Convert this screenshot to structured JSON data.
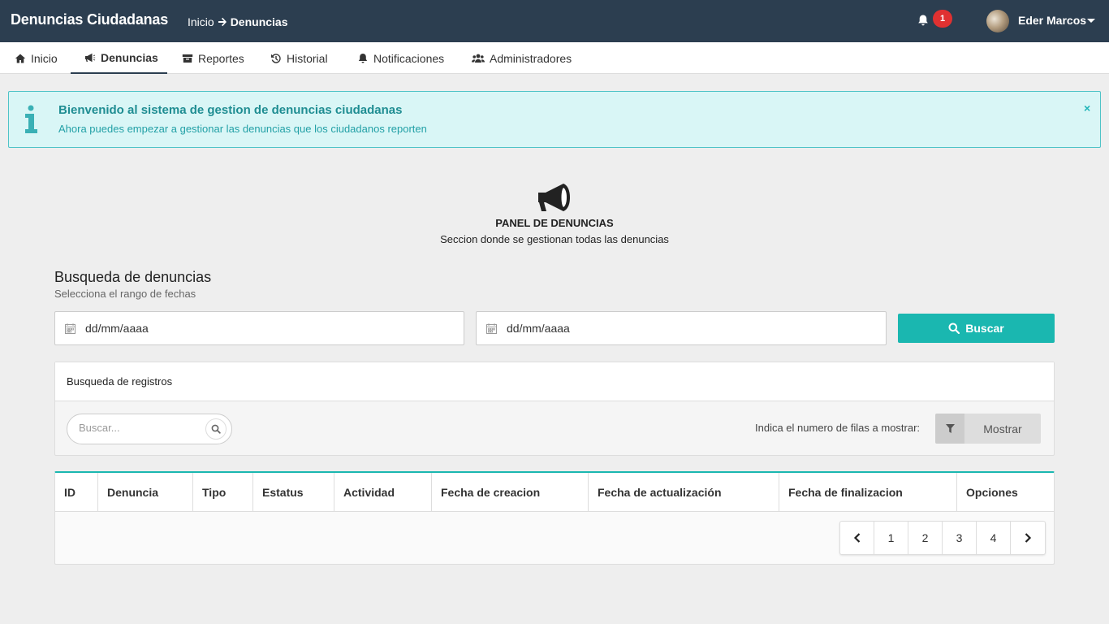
{
  "app": {
    "title": "Denuncias Ciudadanas",
    "breadcrumb": [
      "Inicio",
      "Denuncias"
    ],
    "notification_count": "1",
    "user_name": "Eder Marcos",
    "header_bg": "#2c3e50"
  },
  "nav": {
    "items": [
      {
        "label": "Inicio",
        "icon": "home-icon"
      },
      {
        "label": "Denuncias",
        "icon": "bullhorn-icon",
        "active": true
      },
      {
        "label": "Reportes",
        "icon": "archive-icon"
      },
      {
        "label": "Historial",
        "icon": "history-icon"
      },
      {
        "label": "Notificaciones",
        "icon": "bell-icon"
      },
      {
        "label": "Administradores",
        "icon": "users-icon"
      }
    ]
  },
  "alert": {
    "title": "Bienvenido al sistema de gestion de denuncias ciudadanas",
    "message": "Ahora puedes empezar a gestionar las denuncias que los ciudadanos reporten",
    "close": "×",
    "color": "#d9f6f6"
  },
  "panel": {
    "title": "PANEL DE DENUNCIAS",
    "subtitle": "Seccion donde se gestionan todas las denuncias"
  },
  "search": {
    "title": "Busqueda de denuncias",
    "subtitle": "Selecciona el rango de fechas",
    "date_from": "dd/mm/aaaa",
    "date_to": "dd/mm/aaaa",
    "button": "Buscar",
    "accent": "#1ab7b0"
  },
  "records": {
    "title": "Busqueda de registros",
    "search_placeholder": "Buscar...",
    "rows_label": "Indica el numero de filas a mostrar:",
    "show_button": "Mostrar"
  },
  "table": {
    "columns": [
      "ID",
      "Denuncia",
      "Tipo",
      "Estatus",
      "Actividad",
      "Fecha de creacion",
      "Fecha de actualización",
      "Fecha de finalizacion",
      "Opciones"
    ],
    "pages": [
      "1",
      "2",
      "3",
      "4"
    ]
  }
}
